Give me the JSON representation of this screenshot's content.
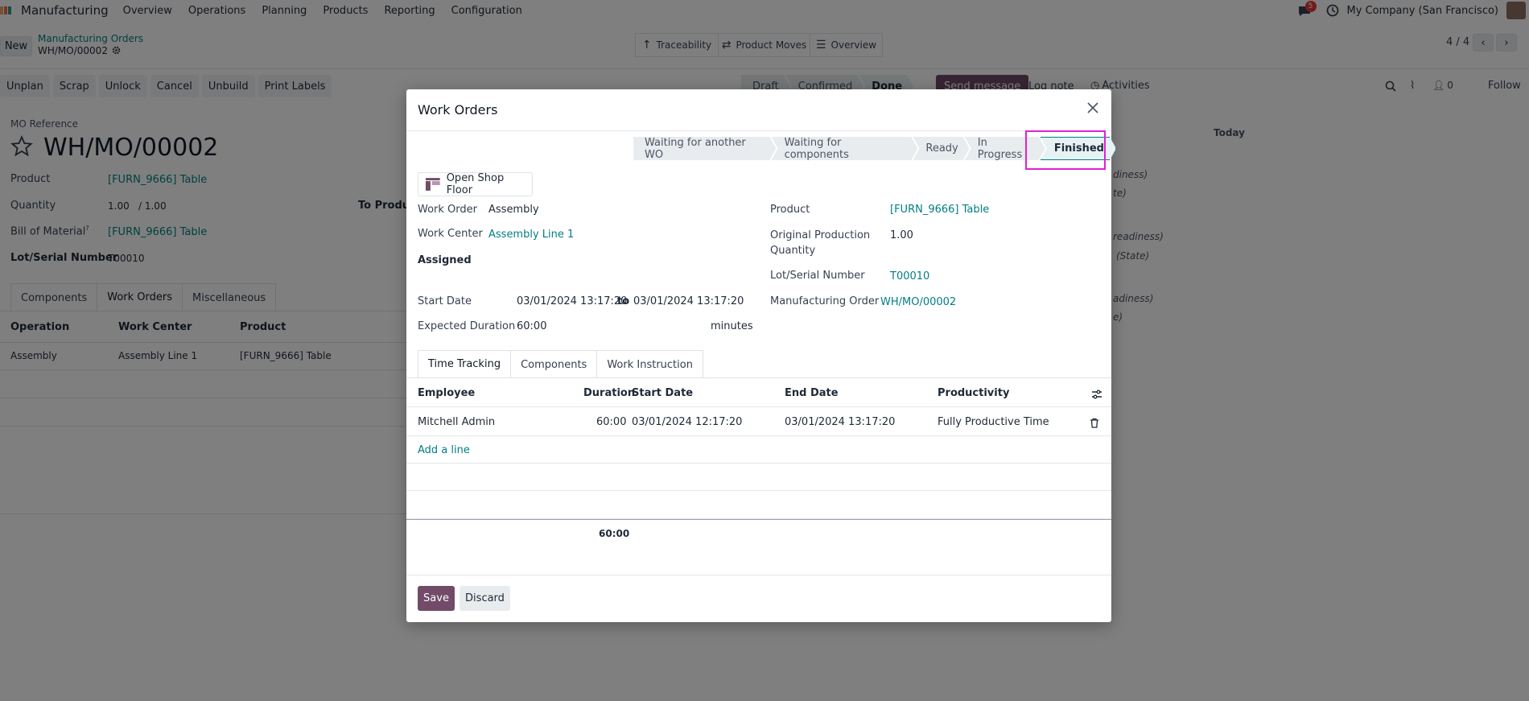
{
  "nav": {
    "brand": "Manufacturing",
    "menu": [
      "Overview",
      "Operations",
      "Planning",
      "Products",
      "Reporting",
      "Configuration"
    ],
    "notif_count": "5",
    "company": "My Company (San Francisco)"
  },
  "control": {
    "new_label": "New",
    "breadcrumb_parent": "Manufacturing Orders",
    "breadcrumb_current": "WH/MO/00002",
    "smart_buttons": [
      "Traceability",
      "Product Moves",
      "Overview"
    ],
    "pager": "4 / 4"
  },
  "actions": [
    "Unplan",
    "Scrap",
    "Unlock",
    "Cancel",
    "Unbuild",
    "Print Labels"
  ],
  "mo_status": [
    "Draft",
    "Confirmed",
    "Done"
  ],
  "chatter": {
    "send": "Send message",
    "log": "Log note",
    "activities": "Activities",
    "followers": "0",
    "follow": "Follow",
    "today": "Today",
    "frag1": "diness)",
    "frag2": "te)",
    "frag3": "readiness)",
    "frag4": "(State)",
    "frag5": "adiness)",
    "frag6": "e)"
  },
  "form": {
    "ref_label": "MO Reference",
    "ref": "WH/MO/00002",
    "product_label": "Product",
    "product": "[FURN_9666] Table",
    "qty_label": "Quantity",
    "qty": "1.00",
    "qty_total": "/ 1.00",
    "to_produce": "To Produc",
    "bom_label": "Bill of Material",
    "bom_sup": "?",
    "bom": "[FURN_9666] Table",
    "lot_label": "Lot/Serial Number",
    "lot": "T00010",
    "tabs": [
      "Components",
      "Work Orders",
      "Miscellaneous"
    ],
    "cols": [
      "Operation",
      "Work Center",
      "Product"
    ],
    "row": [
      "Assembly",
      "Assembly Line 1",
      "[FURN_9666] Table"
    ]
  },
  "modal": {
    "title": "Work Orders",
    "stages": [
      "Waiting for another WO",
      "Waiting for components",
      "Ready",
      "In Progress",
      "Finished"
    ],
    "shop_floor": "Open Shop Floor",
    "wo_label": "Work Order",
    "wo": "Assembly",
    "wc_label": "Work Center",
    "wc": "Assembly Line 1",
    "assigned_label": "Assigned",
    "start_label": "Start Date",
    "start": "03/01/2024 13:17:20",
    "to": "to",
    "end": "03/01/2024 13:17:20",
    "dur_label": "Expected Duration",
    "dur": "60:00",
    "minutes": "minutes",
    "product_label": "Product",
    "product": "[FURN_9666] Table",
    "orig_qty_label1": "Original Production",
    "orig_qty_label2": "Quantity",
    "orig_qty": "1.00",
    "lot_label": "Lot/Serial Number",
    "lot": "T00010",
    "mo_label": "Manufacturing Order",
    "mo": "WH/MO/00002",
    "tabs": [
      "Time Tracking",
      "Components",
      "Work Instruction"
    ],
    "cols": [
      "Employee",
      "Duration",
      "Start Date",
      "End Date",
      "Productivity"
    ],
    "row": {
      "employee": "Mitchell Admin",
      "duration": "60:00",
      "start": "03/01/2024 12:17:20",
      "end": "03/01/2024 13:17:20",
      "productivity": "Fully Productive Time"
    },
    "add_line": "Add a line",
    "total": "60:00",
    "save": "Save",
    "discard": "Discard"
  }
}
